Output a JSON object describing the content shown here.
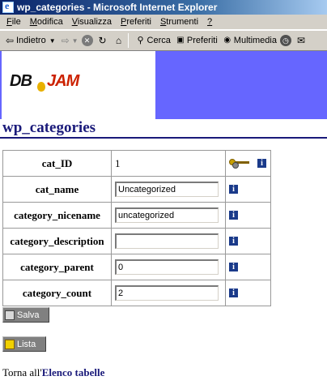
{
  "window": {
    "title": "wp_categories - Microsoft Internet Explorer"
  },
  "menu": [
    {
      "label": "File",
      "u": "F",
      "rest": "ile"
    },
    {
      "label": "Modifica",
      "u": "M",
      "rest": "odifica"
    },
    {
      "label": "Visualizza",
      "u": "V",
      "rest": "isualizza"
    },
    {
      "label": "Preferiti",
      "u": "P",
      "rest": "referiti"
    },
    {
      "label": "Strumenti",
      "u": "S",
      "rest": "trumenti"
    },
    {
      "label": "?",
      "u": "?",
      "rest": ""
    }
  ],
  "toolbar": {
    "back_label": "Indietro",
    "search_label": "Cerca",
    "favorites_label": "Preferiti",
    "media_label": "Multimedia"
  },
  "page": {
    "title": "wp_categories",
    "logo_db": "DB",
    "logo_jam": "JAM"
  },
  "fields": [
    {
      "label": "cat_ID",
      "value": "1",
      "type": "text"
    },
    {
      "label": "cat_name",
      "value": "Uncategorized",
      "type": "input"
    },
    {
      "label": "category_nicename",
      "value": "uncategorized",
      "type": "input"
    },
    {
      "label": "category_description",
      "value": "",
      "type": "input"
    },
    {
      "label": "category_parent",
      "value": "0",
      "type": "input"
    },
    {
      "label": "category_count",
      "value": "2",
      "type": "input"
    }
  ],
  "buttons": {
    "save_label": "Salva",
    "list_label": "Lista"
  },
  "footer": {
    "prefix": "Torna all'",
    "link": "Elenco tabelle"
  },
  "colors": {
    "header_blue": "#6666ff",
    "title_navy": "#1a1a7a",
    "info_blue": "#1a3a8a"
  }
}
